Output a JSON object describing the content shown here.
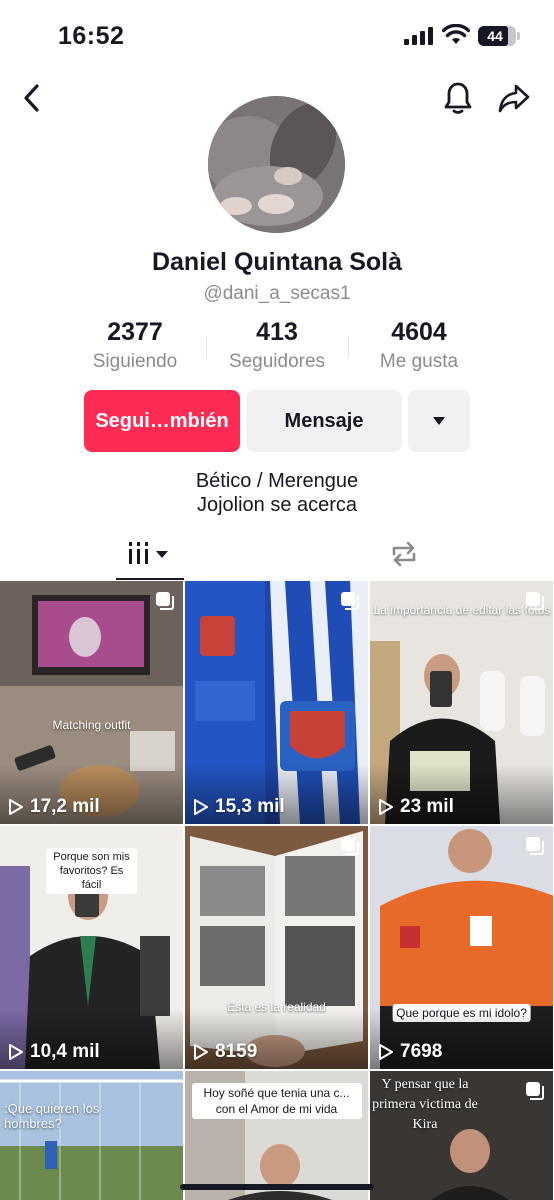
{
  "status_bar": {
    "time": "16:52",
    "battery": "44"
  },
  "profile": {
    "name": "Daniel Quintana Solà",
    "handle": "@dani_a_secas1",
    "stats": [
      {
        "value": "2377",
        "label": "Siguiendo"
      },
      {
        "value": "413",
        "label": "Seguidores"
      },
      {
        "value": "4604",
        "label": "Me gusta"
      }
    ],
    "follow_label": "Segui…mbién",
    "message_label": "Mensaje",
    "bio": [
      "Bético / Merengue",
      "Jojolion se acerca"
    ]
  },
  "tabs": {
    "videos_icon": "grid-icon",
    "repost_icon": "repost-icon"
  },
  "colors": {
    "accent": "#fe2c55",
    "text": "#161823",
    "muted": "#8a8b91",
    "button_bg": "#f1f1f2"
  },
  "videos": [
    {
      "views": "17,2 mil",
      "caption": "Matching outfit"
    },
    {
      "views": "15,3 mil",
      "caption": ""
    },
    {
      "views": "23 mil",
      "caption": "La importancia de editar las fotos"
    },
    {
      "views": "10,4 mil",
      "caption": "Porque son mis favoritos? Es fácil"
    },
    {
      "views": "8159",
      "caption": "Esta es la realidad"
    },
    {
      "views": "7698",
      "caption": "Que porque es mi idolo?"
    },
    {
      "views": "",
      "caption": ":Que quieren los hombres?"
    },
    {
      "views": "",
      "caption": "Hoy soñé que tenia una c... con el Amor de mi vida"
    },
    {
      "views": "",
      "caption": "Y pensar que la primera victima de Kira"
    }
  ]
}
